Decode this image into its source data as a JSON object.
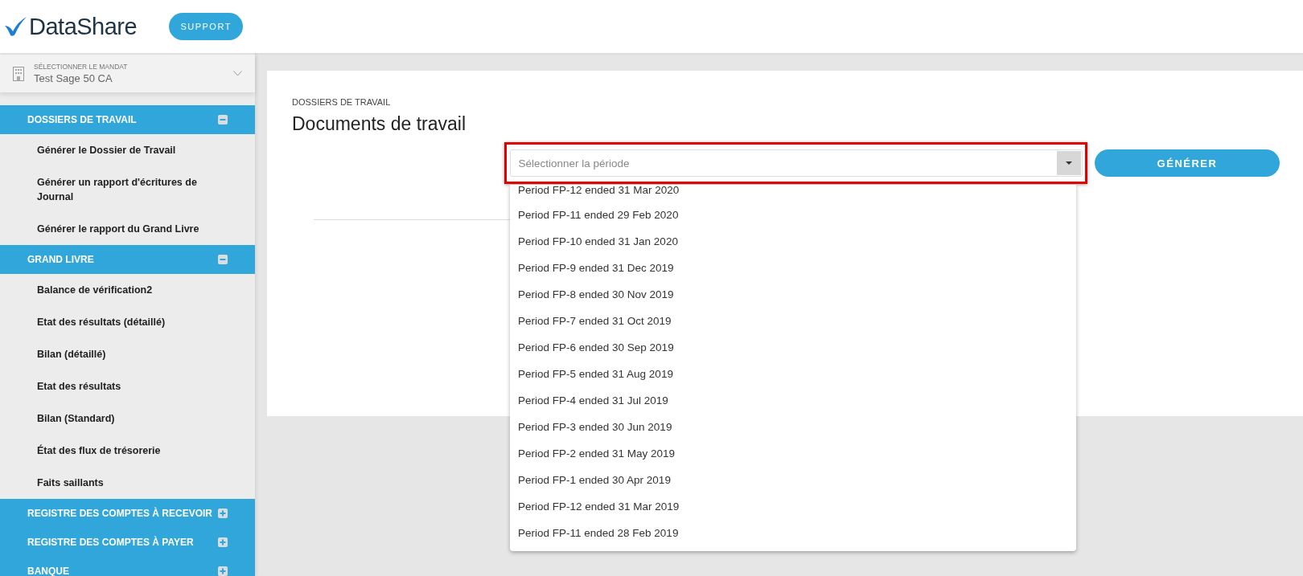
{
  "header": {
    "logo": "DataShare",
    "support_button": "SUPPORT"
  },
  "sidebar": {
    "mandate": {
      "label": "SÉLECTIONNER LE MANDAT",
      "value": "Test Sage 50 CA"
    },
    "sections": [
      {
        "title": "DOSSIERS DE TRAVAIL",
        "expanded": true,
        "items": [
          "Générer le Dossier de Travail",
          "Générer un rapport d'écritures de Journal",
          "Générer le rapport du Grand Livre"
        ]
      },
      {
        "title": "GRAND LIVRE",
        "expanded": true,
        "items": [
          "Balance de vérification2",
          "Etat des résultats (détaillé)",
          "Bilan (détaillé)",
          "Etat des résultats",
          "Bilan (Standard)",
          "État des flux de trésorerie",
          "Faits saillants"
        ]
      },
      {
        "title": "REGISTRE DES COMPTES À RECEVOIR",
        "expanded": false
      },
      {
        "title": "REGISTRE DES COMPTES À PAYER",
        "expanded": false
      },
      {
        "title": "BANQUE",
        "expanded": false
      }
    ]
  },
  "main": {
    "breadcrumb": "DOSSIERS DE TRAVAIL",
    "title": "Documents de travail",
    "period_select": {
      "placeholder": "Sélectionner la période",
      "highlighted": true,
      "expanded": true,
      "options": [
        "Period FP-12 ended 31 Mar 2020",
        "Period FP-11 ended 29 Feb 2020",
        "Period FP-10 ended 31 Jan 2020",
        "Period FP-9 ended 31 Dec 2019",
        "Period FP-8 ended 30 Nov 2019",
        "Period FP-7 ended 31 Oct 2019",
        "Period FP-6 ended 30 Sep 2019",
        "Period FP-5 ended 31 Aug 2019",
        "Period FP-4 ended 31 Jul 2019",
        "Period FP-3 ended 30 Jun 2019",
        "Period FP-2 ended 31 May 2019",
        "Period FP-1 ended 30 Apr 2019",
        "Period FP-12 ended 31 Mar 2019",
        "Period FP-11 ended 28 Feb 2019"
      ]
    },
    "generate_button": "GÉNÉRER"
  }
}
